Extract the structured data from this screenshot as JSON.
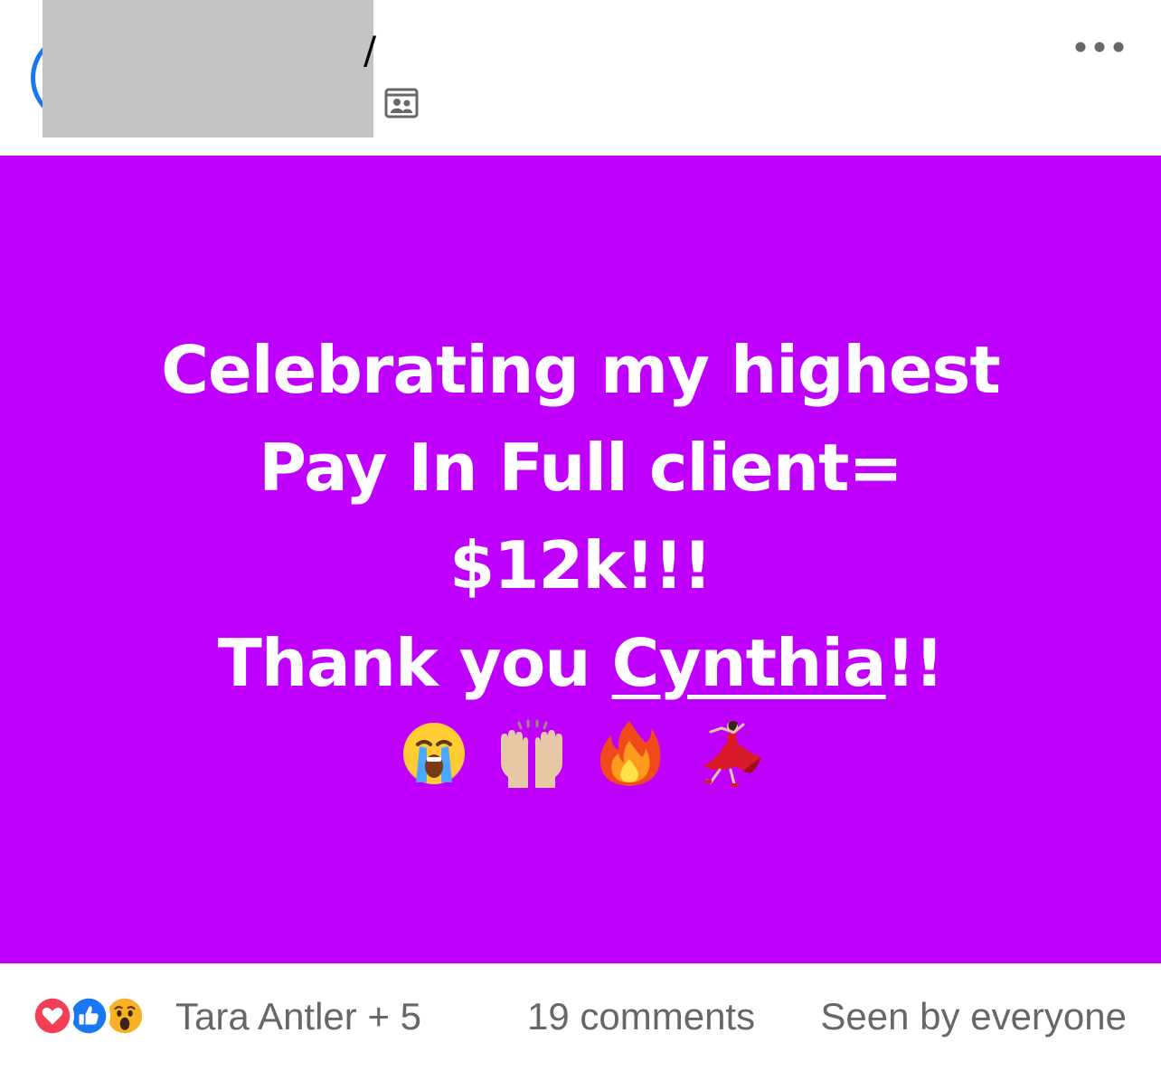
{
  "post": {
    "background_color": "#c000ff",
    "lines": [
      "Celebrating my highest",
      "Pay In Full client=",
      "$12k!!!"
    ],
    "thanks_prefix": "Thank you ",
    "mention_name": "Cynthia",
    "thanks_suffix": "!!",
    "emojis": [
      "loudly-crying-face",
      "raising-hands",
      "fire",
      "woman-dancing"
    ]
  },
  "header": {
    "name_visible_fragment": "/",
    "audience_icon": "group-icon",
    "more_icon": "more-options-icon"
  },
  "footer": {
    "reaction_icons": [
      "love-reaction-icon",
      "like-reaction-icon",
      "wow-reaction-icon"
    ],
    "reacted_by": "Tara Antler + 5",
    "comments": "19 comments",
    "seen_by": "Seen by everyone"
  },
  "colors": {
    "purple": "#c000ff",
    "love": "#f33e58",
    "like": "#1877f2",
    "wow": "#f7b125",
    "secondary_text": "#65676b",
    "avatar_ring": "#1877f2",
    "redaction": "#c4c4c4"
  }
}
